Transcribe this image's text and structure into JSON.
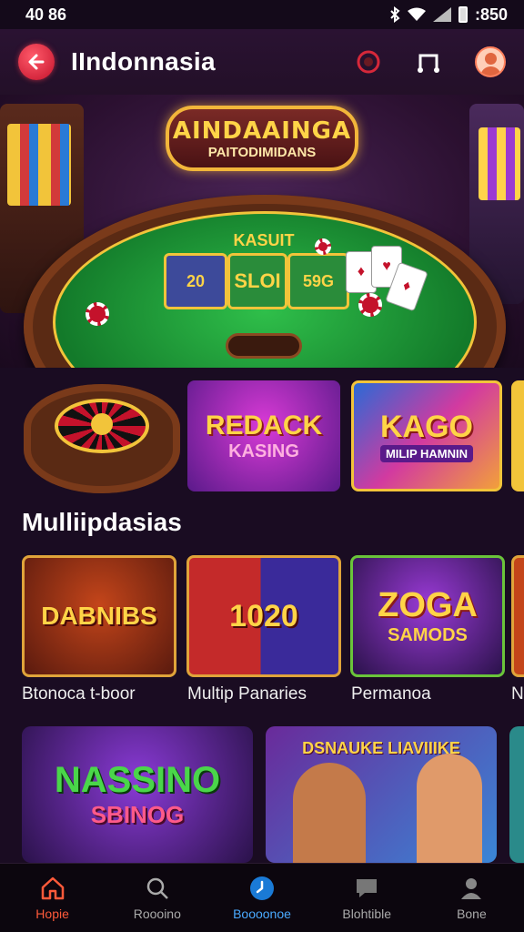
{
  "status": {
    "time": "40 86",
    "right_text": ":850"
  },
  "header": {
    "title": "IIndonnasia"
  },
  "hero": {
    "banner_line1": "AINDAAINGA",
    "banner_line2": "PAITODIMIDANS",
    "table_title": "KASUIT",
    "bet1": "20",
    "bet2": "SLOI",
    "bet3": "59G"
  },
  "promo_tiles": [
    {
      "line1": "REDACK",
      "line2": "KASING"
    },
    {
      "line1": "KAGO",
      "line2": "MILIP HAMNIN"
    }
  ],
  "section": {
    "title": "Mulliipdasias"
  },
  "games": [
    {
      "art": "DABNIBS",
      "label": "Btonoca t-boor"
    },
    {
      "art": "1020",
      "label": "Multip Panaries"
    },
    {
      "art_line1": "ZOGA",
      "art_line2": "SAMODS",
      "label": "Permanoa"
    },
    {
      "label": "N"
    }
  ],
  "bottom_tiles": [
    {
      "line1": "NASSINO",
      "line2": "SBINOG"
    },
    {
      "line1": "DSNAUKE LIAVIIIKE"
    }
  ],
  "nav": [
    {
      "label": "Hopie",
      "icon": "home-icon"
    },
    {
      "label": "Roooino",
      "icon": "search-icon"
    },
    {
      "label": "Boooonoe",
      "icon": "clock-icon"
    },
    {
      "label": "Blohtible",
      "icon": "chat-icon"
    },
    {
      "label": "Bone",
      "icon": "profile-icon"
    }
  ],
  "colors": {
    "accent": "#ff5a3a",
    "nav_active_mid": "#4aaaff",
    "background": "#1a0c22",
    "gold": "#f2c43a"
  }
}
